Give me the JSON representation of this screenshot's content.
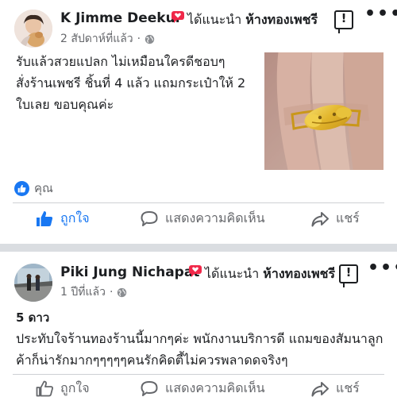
{
  "posts": [
    {
      "author": "K Jimme Deekul",
      "recommend_text": "ได้แนะนำ",
      "page_name": "ห้างทองเพชรี",
      "time": "2 สัปดาห์ที่แล้ว",
      "body_lines": [
        "รับแล้วสวยแปลก ไม่เหมือนใครดีชอบๆ",
        "สั่งร้านเพชรี ชิ้นที่ 4 แล้ว แถมกระเป๋าให้ 2",
        "ใบเลย ขอบคุณค่ะ"
      ],
      "reaction_label": "คุณ",
      "actions": {
        "like": "ถูกใจ",
        "comment": "แสดงความคิดเห็น",
        "share": "แชร์"
      }
    },
    {
      "author": "Piki Jung Nichapat",
      "recommend_text": "ได้แนะนำ",
      "page_name": "ห้างทองเพชรี",
      "time": "1 ปีที่แล้ว",
      "stars": "5 ดาว",
      "body_lines": [
        "ประทับใจร้านทองร้านนี้มากๆค่ะ พนักงานบริการดี แถมของสัมนาลูก",
        "ค้าก็น่ารักมากๆๆๆๆๆคนรักคิดตี้ไม่ควรพลาดดจริงๆ"
      ],
      "actions": {
        "like": "ถูกใจ",
        "comment": "แสดงความคิดเห็น",
        "share": "แชร์"
      }
    }
  ],
  "icons": {
    "recommend": "recommend-flag-icon",
    "privacy": "globe-icon",
    "report": "report-flag-icon",
    "more": "more-dots-icon",
    "like": "thumbs-up-icon",
    "comment": "comment-bubble-icon",
    "share": "share-arrow-icon"
  },
  "colors": {
    "facebook_blue": "#1877f2",
    "recommend_red": "#f02849",
    "secondary_text": "#65676b",
    "separator": "#dadde1"
  }
}
